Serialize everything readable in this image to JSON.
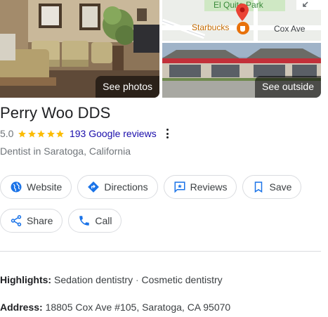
{
  "photos": {
    "main_label": "See photos",
    "outside_label": "See outside",
    "map_labels": {
      "park": "El Quito Park",
      "poi": "Starbucks",
      "street": "Cox Ave"
    }
  },
  "business": {
    "name": "Perry Woo DDS",
    "rating": "5.0",
    "stars": 5,
    "reviews": "193 Google reviews",
    "category": "Dentist in Saratoga, California"
  },
  "actions": {
    "website": "Website",
    "directions": "Directions",
    "reviews": "Reviews",
    "save": "Save",
    "share": "Share",
    "call": "Call"
  },
  "details": {
    "highlights_label": "Highlights:",
    "highlights": [
      "Sedation dentistry",
      "Cosmetic dentistry"
    ],
    "highlights_sep": " · ",
    "address_label": "Address:",
    "address": "18805 Cox Ave #105, Saratoga, CA 95070"
  },
  "colors": {
    "star": "#fbbc04",
    "link": "#1a0dab",
    "icon_blue": "#1a73e8",
    "border": "#dadce0"
  }
}
